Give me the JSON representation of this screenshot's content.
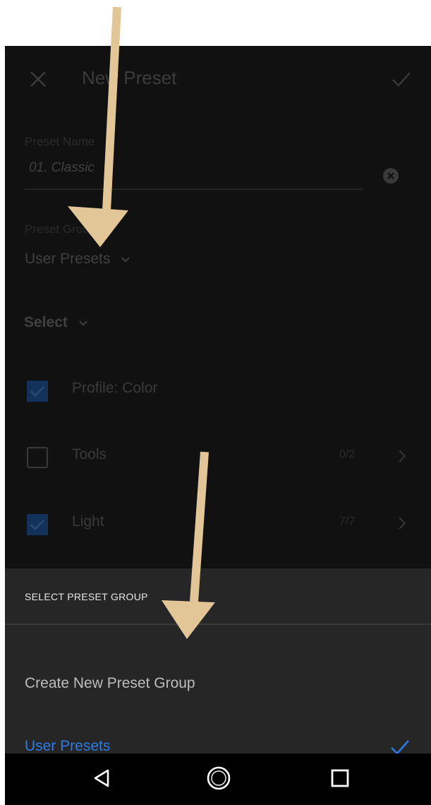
{
  "header": {
    "title": "New Preset",
    "close_icon": "close-icon",
    "confirm_icon": "checkmark-icon"
  },
  "preset_name": {
    "label": "Preset Name",
    "value": "01. Classic"
  },
  "preset_group": {
    "label": "Preset Group",
    "value": "User Presets"
  },
  "select": {
    "label": "Select"
  },
  "settings": [
    {
      "label": "Profile: Color",
      "checked": true,
      "count": ""
    },
    {
      "label": "Tools",
      "checked": false,
      "count": "0/2"
    },
    {
      "label": "Light",
      "checked": true,
      "count": "7/7"
    }
  ],
  "sheet": {
    "title": "SELECT PRESET GROUP",
    "items": [
      {
        "label": "Create New Preset Group",
        "selected": false
      },
      {
        "label": "User Presets",
        "selected": true
      }
    ]
  },
  "colors": {
    "accent": "#2d7be5",
    "annotation_arrow": "#e3c698",
    "sheet_bg": "#262626",
    "screen_bg": "#111111"
  },
  "navbar": {
    "icons": [
      "back-icon",
      "home-icon",
      "recents-icon"
    ]
  }
}
